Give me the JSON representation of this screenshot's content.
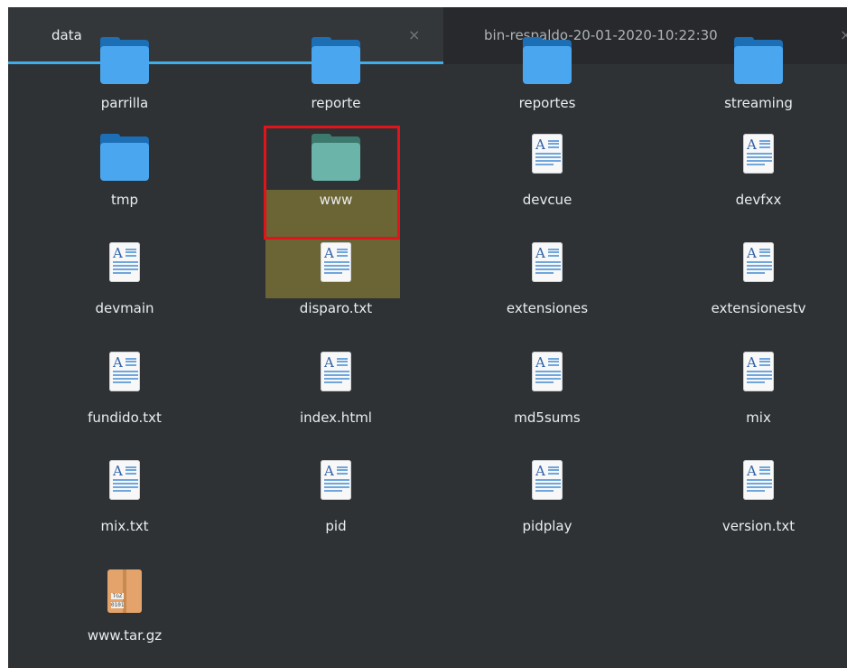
{
  "tabs": [
    {
      "label": "data",
      "close": "×",
      "active": true
    },
    {
      "label": "bin-respaldo-20-01-2020-10:22:30",
      "close": "×",
      "active": false
    }
  ],
  "items": [
    {
      "name": "parrilla",
      "type": "folder-icon"
    },
    {
      "name": "reporte",
      "type": "folder-icon"
    },
    {
      "name": "reportes",
      "type": "folder-icon"
    },
    {
      "name": "streaming",
      "type": "folder-icon"
    },
    {
      "name": "tmp",
      "type": "folder-icon"
    },
    {
      "name": "www",
      "type": "folder-icon",
      "selected": true
    },
    {
      "name": "devcue",
      "type": "text-file-icon"
    },
    {
      "name": "devfxx",
      "type": "text-file-icon"
    },
    {
      "name": "devmain",
      "type": "text-file-icon"
    },
    {
      "name": "disparo.txt",
      "type": "text-file-icon"
    },
    {
      "name": "extensiones",
      "type": "text-file-icon"
    },
    {
      "name": "extensionestv",
      "type": "text-file-icon"
    },
    {
      "name": "fundido.txt",
      "type": "text-file-icon"
    },
    {
      "name": "index.html",
      "type": "text-file-icon"
    },
    {
      "name": "md5sums",
      "type": "text-file-icon"
    },
    {
      "name": "mix",
      "type": "text-file-icon"
    },
    {
      "name": "mix.txt",
      "type": "text-file-icon"
    },
    {
      "name": "pid",
      "type": "text-file-icon"
    },
    {
      "name": "pidplay",
      "type": "text-file-icon"
    },
    {
      "name": "version.txt",
      "type": "text-file-icon"
    },
    {
      "name": "www.tar.gz",
      "type": "archive-icon",
      "archive_tags": [
        "TGZ",
        "0101"
      ]
    }
  ],
  "text_icon_glyph": "A",
  "colors": {
    "accent": "#3daee9",
    "background": "#2f3235",
    "selection": "#6b6434",
    "highlight_border": "#e0141a"
  }
}
